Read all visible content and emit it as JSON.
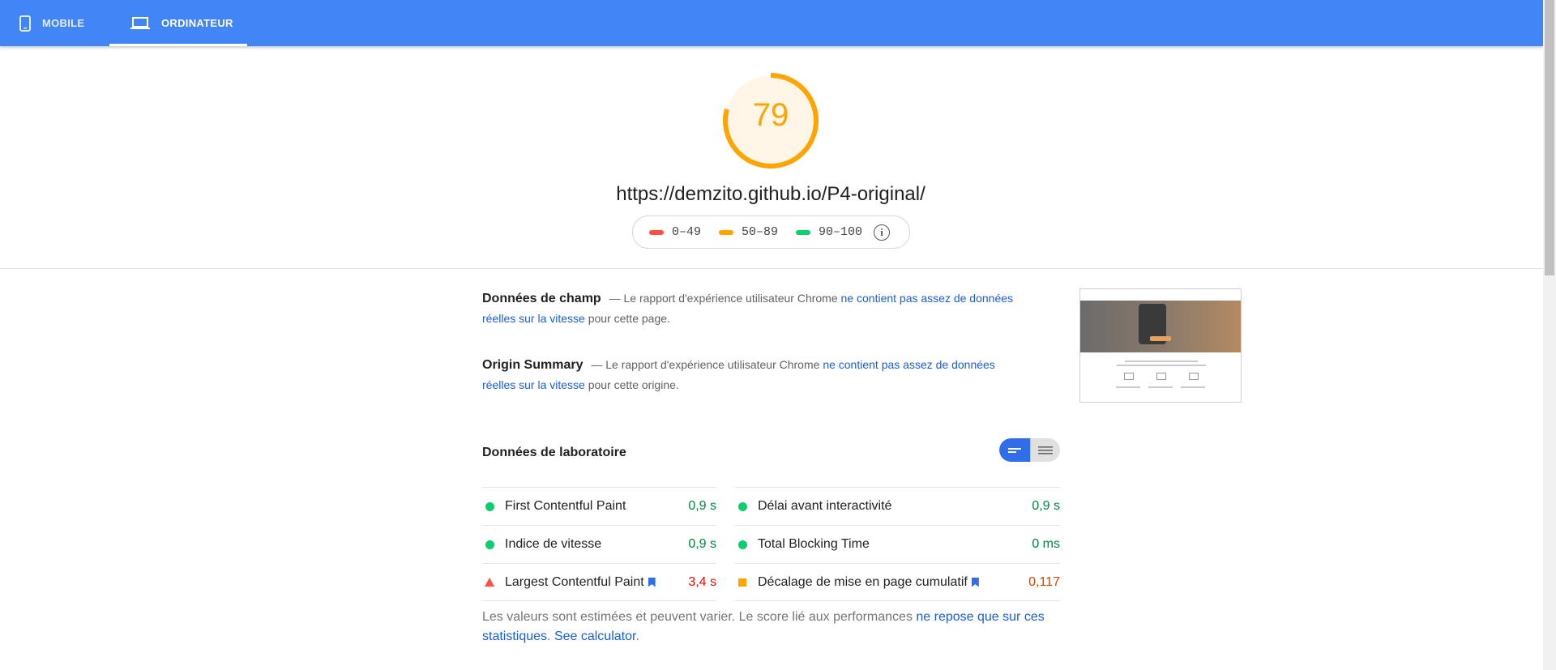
{
  "tabs": {
    "mobile_label": "MOBILE",
    "desktop_label": "ORDINATEUR",
    "active": "desktop"
  },
  "score": {
    "value": 79,
    "max": 100,
    "color": "#ffa400"
  },
  "url": "https://demzito.github.io/P4-original/",
  "legend": {
    "ranges": [
      {
        "label": "0–49",
        "color": "#ff4e42"
      },
      {
        "label": "50–89",
        "color": "#ffa400"
      },
      {
        "label": "90–100",
        "color": "#0cce6b"
      }
    ],
    "info_glyph": "i"
  },
  "field_data": {
    "title": "Données de champ",
    "text_before": " — Le rapport d'expérience utilisateur Chrome ",
    "link": "ne contient pas assez de données réelles sur la vitesse",
    "text_after": " pour cette page."
  },
  "origin_summary": {
    "title": "Origin Summary",
    "text_before": " — Le rapport d'expérience utilisateur Chrome ",
    "link": "ne contient pas assez de données réelles sur la vitesse",
    "text_after": " pour cette origine."
  },
  "lab_data": {
    "title": "Données de laboratoire",
    "left": [
      {
        "label": "First Contentful Paint",
        "value": "0,9 s",
        "status": "pass"
      },
      {
        "label": "Indice de vitesse",
        "value": "0,9 s",
        "status": "pass"
      },
      {
        "label": "Largest Contentful Paint",
        "value": "3,4 s",
        "status": "fail"
      }
    ],
    "right": [
      {
        "label": "Délai avant interactivité",
        "value": "0,9 s",
        "status": "pass"
      },
      {
        "label": "Total Blocking Time",
        "value": "0 ms",
        "status": "pass"
      },
      {
        "label": "Décalage de mise en page cumulatif",
        "value": "0,117",
        "status": "average"
      }
    ]
  },
  "footnote": {
    "text": "Les valeurs sont estimées et peuvent varier. Le score lié aux performances ",
    "link1": "ne repose que sur ces statistiques",
    "sep": ". ",
    "link2": "See calculator",
    "end": "."
  }
}
